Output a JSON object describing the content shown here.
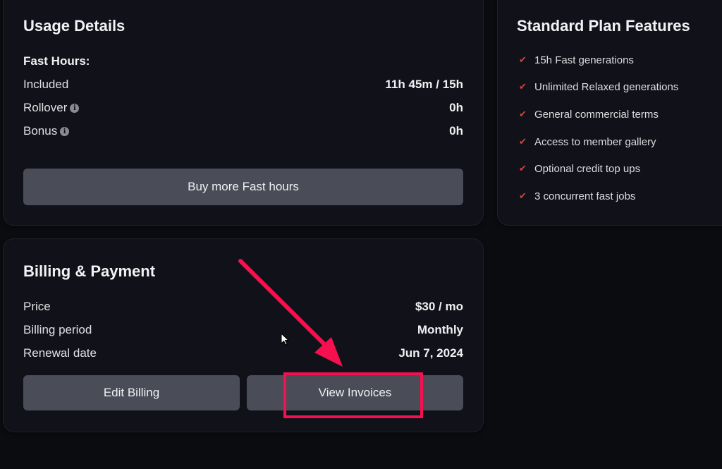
{
  "usage": {
    "title": "Usage Details",
    "fast_hours_label": "Fast Hours:",
    "rows": [
      {
        "label": "Included",
        "value": "11h 45m / 15h",
        "info": false
      },
      {
        "label": "Rollover",
        "value": "0h",
        "info": true
      },
      {
        "label": "Bonus",
        "value": "0h",
        "info": true
      }
    ],
    "info_icon_glyph": "i",
    "buy_button": "Buy more Fast hours"
  },
  "features": {
    "title": "Standard Plan Features",
    "check_glyph": "✔",
    "check_color": "#d8433c",
    "items": [
      "15h Fast generations",
      "Unlimited Relaxed generations",
      "General commercial terms",
      "Access to member gallery",
      "Optional credit top ups",
      "3 concurrent fast jobs"
    ]
  },
  "billing": {
    "title": "Billing & Payment",
    "rows": [
      {
        "label": "Price",
        "value": "$30 / mo"
      },
      {
        "label": "Billing period",
        "value": "Monthly"
      },
      {
        "label": "Renewal date",
        "value": "Jun 7, 2024"
      }
    ],
    "edit_button": "Edit Billing",
    "invoices_button": "View Invoices"
  },
  "annotation": {
    "color": "#f5104f",
    "target": "View Invoices"
  }
}
